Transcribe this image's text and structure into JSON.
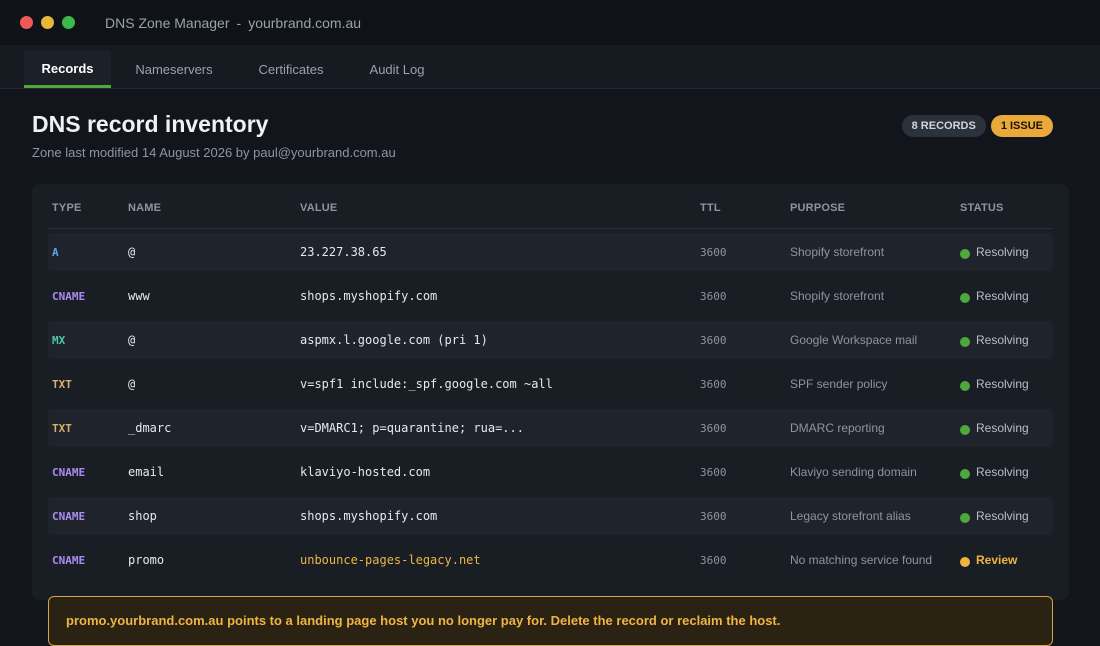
{
  "window": {
    "app_name": "DNS Zone Manager",
    "separator": "-",
    "domain": "yourbrand.com.au"
  },
  "tabs": [
    {
      "label": "Records",
      "active": true
    },
    {
      "label": "Nameservers",
      "active": false
    },
    {
      "label": "Certificates",
      "active": false
    },
    {
      "label": "Audit Log",
      "active": false
    }
  ],
  "page": {
    "title": "DNS record inventory",
    "subtitle": "Zone last modified 14 August 2026 by paul@yourbrand.com.au",
    "badges": {
      "records": "8 RECORDS",
      "issues": "1 ISSUE"
    }
  },
  "table": {
    "columns": {
      "type": "TYPE",
      "name": "NAME",
      "value": "VALUE",
      "ttl": "TTL",
      "purpose": "PURPOSE",
      "status": "STATUS"
    },
    "rows": [
      {
        "type": "A",
        "name": "@",
        "value": "23.227.38.65",
        "ttl": "3600",
        "purpose": "Shopify storefront",
        "status": "Resolving"
      },
      {
        "type": "CNAME",
        "name": "www",
        "value": "shops.myshopify.com",
        "ttl": "3600",
        "purpose": "Shopify storefront",
        "status": "Resolving"
      },
      {
        "type": "MX",
        "name": "@",
        "value": "aspmx.l.google.com (pri 1)",
        "ttl": "3600",
        "purpose": "Google Workspace mail",
        "status": "Resolving"
      },
      {
        "type": "TXT",
        "name": "@",
        "value": "v=spf1 include:_spf.google.com ~all",
        "ttl": "3600",
        "purpose": "SPF sender policy",
        "status": "Resolving"
      },
      {
        "type": "TXT",
        "name": "_dmarc",
        "value": "v=DMARC1; p=quarantine; rua=...",
        "ttl": "3600",
        "purpose": "DMARC reporting",
        "status": "Resolving"
      },
      {
        "type": "CNAME",
        "name": "email",
        "value": "klaviyo-hosted.com",
        "ttl": "3600",
        "purpose": "Klaviyo sending domain",
        "status": "Resolving"
      },
      {
        "type": "CNAME",
        "name": "shop",
        "value": "shops.myshopify.com",
        "ttl": "3600",
        "purpose": "Legacy storefront alias",
        "status": "Resolving"
      },
      {
        "type": "CNAME",
        "name": "promo",
        "value": "unbounce-pages-legacy.net",
        "ttl": "3600",
        "purpose": "No matching service found",
        "status": "Review"
      }
    ]
  },
  "alert": {
    "message": "promo.yourbrand.com.au points to a landing page host you no longer pay for. Delete the record or reclaim the host."
  },
  "colors": {
    "type_A": "#5aa6f0",
    "type_CNAME": "#a98cf0",
    "type_MX": "#4fc7a0",
    "type_TXT": "#d8b06a",
    "status_ok": "#4fa83d",
    "status_review": "#f0b443",
    "accent": "#4fa83d"
  }
}
